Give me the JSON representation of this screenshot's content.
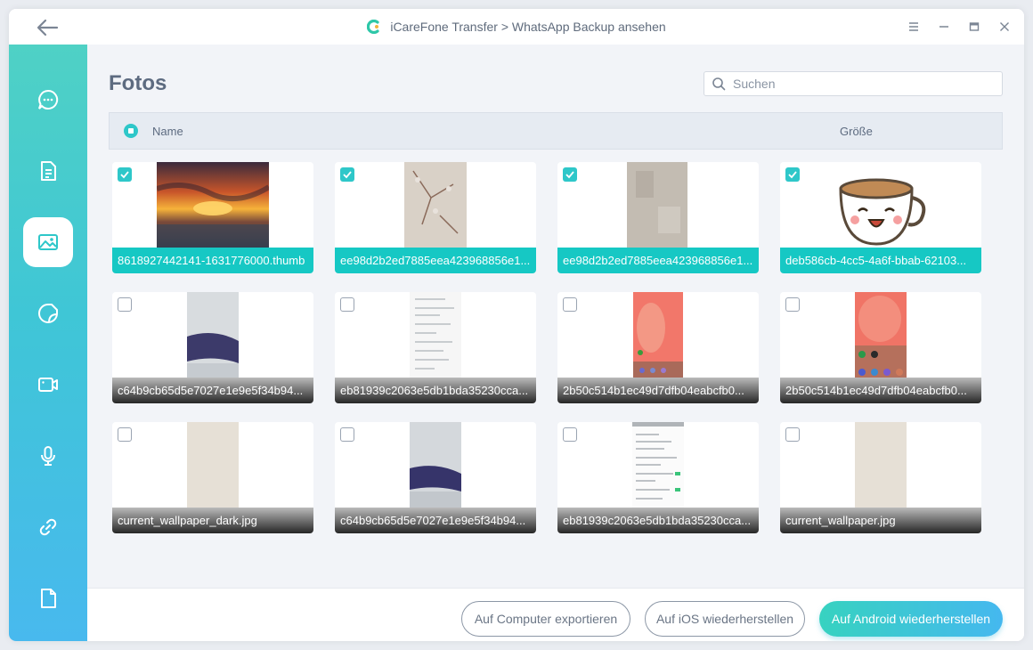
{
  "titlebar": {
    "title": "iCareFone Transfer > WhatsApp Backup ansehen",
    "back_icon": "arrow-left-icon",
    "controls": [
      "menu-icon",
      "minimize-icon",
      "maximize-icon",
      "close-icon"
    ]
  },
  "sidebar": {
    "items": [
      {
        "name": "chat",
        "icon": "chat-bubble-icon",
        "active": false
      },
      {
        "name": "documents",
        "icon": "document-icon",
        "active": false
      },
      {
        "name": "photos",
        "icon": "image-icon",
        "active": true
      },
      {
        "name": "stickers",
        "icon": "sticker-icon",
        "active": false
      },
      {
        "name": "videos",
        "icon": "video-icon",
        "active": false
      },
      {
        "name": "audio",
        "icon": "microphone-icon",
        "active": false
      },
      {
        "name": "links",
        "icon": "link-icon",
        "active": false
      },
      {
        "name": "files",
        "icon": "file-icon",
        "active": false
      }
    ]
  },
  "main": {
    "title": "Fotos",
    "search": {
      "placeholder": "Suchen",
      "value": ""
    },
    "table_header": {
      "name_label": "Name",
      "size_label": "Größe"
    }
  },
  "photos": [
    {
      "name": "8618927442141-1631776000.thumb",
      "selected": true,
      "thumb": "sunset"
    },
    {
      "name": "ee98d2b2ed7885eea423968856e1...",
      "selected": true,
      "thumb": "blossom"
    },
    {
      "name": "ee98d2b2ed7885eea423968856e1...",
      "selected": true,
      "thumb": "fabric"
    },
    {
      "name": "deb586cb-4cc5-4a6f-bbab-62103...",
      "selected": true,
      "thumb": "cup"
    },
    {
      "name": "c64b9cb65d5e7027e1e9e5f34b94...",
      "selected": false,
      "thumb": "bag"
    },
    {
      "name": "eb81939c2063e5db1bda35230cca...",
      "selected": false,
      "thumb": "doc"
    },
    {
      "name": "2b50c514b1ec49d7dfb04eabcfb0...",
      "selected": false,
      "thumb": "hand"
    },
    {
      "name": "2b50c514b1ec49d7dfb04eabcfb0...",
      "selected": false,
      "thumb": "hand2"
    },
    {
      "name": "current_wallpaper_dark.jpg",
      "selected": false,
      "thumb": "beige"
    },
    {
      "name": "c64b9cb65d5e7027e1e9e5f34b94...",
      "selected": false,
      "thumb": "bag2"
    },
    {
      "name": "eb81939c2063e5db1bda35230cca...",
      "selected": false,
      "thumb": "doc2"
    },
    {
      "name": "current_wallpaper.jpg",
      "selected": false,
      "thumb": "beige"
    }
  ],
  "footer": {
    "export_label": "Auf Computer exportieren",
    "ios_label": "Auf iOS wiederherstellen",
    "android_label": "Auf Android wiederherstellen"
  },
  "colors": {
    "accent": "#16c8c4",
    "sidebar_top": "#4fd1c5",
    "sidebar_bottom": "#48b9ee",
    "text_muted": "#5d6b80"
  }
}
